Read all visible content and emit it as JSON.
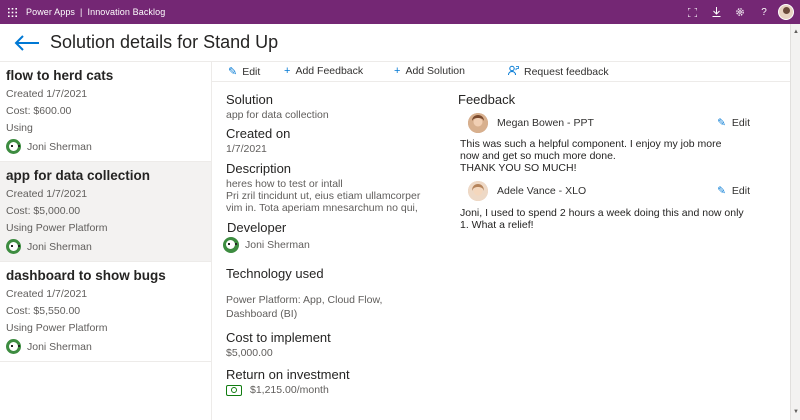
{
  "topbar": {
    "app_name": "Power Apps",
    "separator": "|",
    "app_title": "Innovation Backlog",
    "bg_color": "#742774",
    "icons": [
      "waffle-icon",
      "fit-screen-icon",
      "download-icon",
      "settings-icon",
      "help-icon",
      "user-avatar"
    ]
  },
  "header": {
    "title": "Solution details for Stand Up",
    "back_icon": "arrow-left-icon"
  },
  "list": {
    "items": [
      {
        "title": "flow to herd cats",
        "created": "Created 1/7/2021",
        "cost": "Cost: $600.00",
        "using": "Using",
        "person": "Joni Sherman",
        "selected": false
      },
      {
        "title": "app for data collection",
        "created": "Created 1/7/2021",
        "cost": "Cost: $5,000.00",
        "using": "Using Power Platform",
        "person": "Joni Sherman",
        "selected": true
      },
      {
        "title": "dashboard to show bugs",
        "created": "Created 1/7/2021",
        "cost": "Cost: $5,550.00",
        "using": "Using Power Platform",
        "person": "Joni Sherman",
        "selected": false
      }
    ]
  },
  "commands": {
    "edit": "Edit",
    "add_feedback": "Add Feedback",
    "add_solution": "Add Solution",
    "request_feedback": "Request feedback"
  },
  "detail": {
    "solution_label": "Solution",
    "solution_value": "app for data collection",
    "created_label": "Created on",
    "created_value": "1/7/2021",
    "description_label": "Description",
    "description_line1": "heres how to test or intall",
    "description_line2": "Pri zril tincidunt ut, eius etiam ullamcorper",
    "description_line3": "vim in. Tota aperiam mnesarchum no qui,",
    "developer_label": "Developer",
    "developer_value": "Joni Sherman",
    "technology_label": "Technology used",
    "technology_line1": "Power Platform: App, Cloud Flow,",
    "technology_line2": "Dashboard (BI)",
    "cost_label": "Cost to implement",
    "cost_value": "$5,000.00",
    "roi_label": "Return on investment",
    "roi_value": "$1,215.00/month"
  },
  "feedback": {
    "heading": "Feedback",
    "entries": [
      {
        "name": "Megan Bowen - PPT",
        "edit": "Edit",
        "line1": "This was such a helpful component. I enjoy my job more",
        "line2": "now and get so much more done.",
        "line3": "THANK YOU SO MUCH!"
      },
      {
        "name": "Adele Vance - XLO",
        "edit": "Edit",
        "line1": "Joni, I used to spend 2 hours a week doing this and now only",
        "line2": "1. What a relief!"
      }
    ]
  },
  "colors": {
    "accent": "#0078d4",
    "brand": "#742774",
    "money": "#107c10"
  }
}
